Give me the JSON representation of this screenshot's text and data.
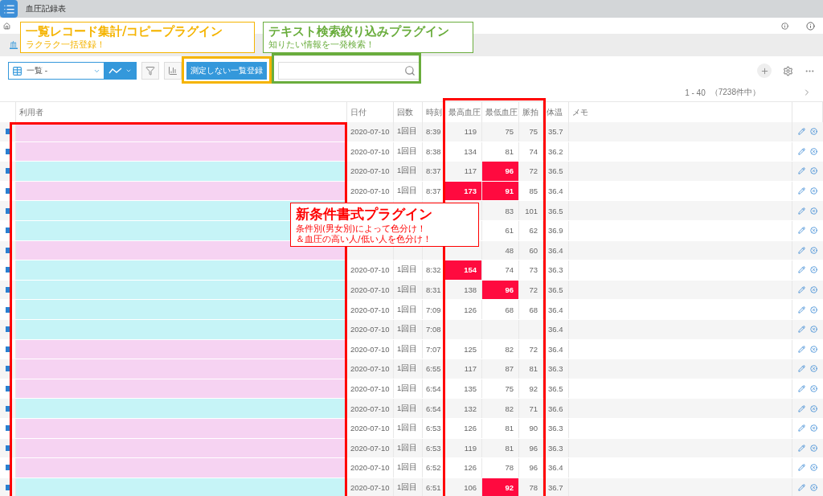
{
  "app": {
    "title": "血圧記録表"
  },
  "breadcrumb": "血",
  "toolbar": {
    "view_select": "一覧 -",
    "button": "測定しない一覧登録"
  },
  "pager": {
    "range": "1 - 40",
    "total": "（7238件中）"
  },
  "table": {
    "columns": [
      "利用者",
      "日付",
      "回数",
      "時刻",
      "最高血圧",
      "最低血圧",
      "脈拍",
      "体温",
      "メモ"
    ],
    "rows": [
      {
        "color": "#f6d3f2",
        "date": "2020-07-10",
        "count": "1回目",
        "time": "8:39",
        "high": "119",
        "high_alert": false,
        "low": "75",
        "low_alert": false,
        "pulse": "75",
        "temp": "35.7"
      },
      {
        "color": "#f6d3f2",
        "date": "2020-07-10",
        "count": "1回目",
        "time": "8:38",
        "high": "134",
        "high_alert": false,
        "low": "81",
        "low_alert": false,
        "pulse": "74",
        "temp": "36.2"
      },
      {
        "color": "#c6f4f7",
        "date": "2020-07-10",
        "count": "1回目",
        "time": "8:37",
        "high": "117",
        "high_alert": false,
        "low": "96",
        "low_alert": true,
        "pulse": "72",
        "temp": "36.5"
      },
      {
        "color": "#f6d3f2",
        "date": "2020-07-10",
        "count": "1回目",
        "time": "8:37",
        "high": "173",
        "high_alert": true,
        "low": "91",
        "low_alert": true,
        "pulse": "85",
        "temp": "36.4"
      },
      {
        "color": "#c6f4f7",
        "low": "83",
        "low_alert": false,
        "pulse": "101",
        "temp": "36.5"
      },
      {
        "color": "#c6f4f7",
        "low": "61",
        "low_alert": false,
        "pulse": "62",
        "temp": "36.9"
      },
      {
        "color": "#f6d3f2",
        "low": "48",
        "low_alert": false,
        "pulse": "60",
        "temp": "36.4"
      },
      {
        "color": "#c6f4f7",
        "date": "2020-07-10",
        "count": "1回目",
        "time": "8:32",
        "high": "154",
        "high_alert": true,
        "low": "74",
        "low_alert": false,
        "pulse": "73",
        "temp": "36.3"
      },
      {
        "color": "#c6f4f7",
        "date": "2020-07-10",
        "count": "1回目",
        "time": "8:31",
        "high": "138",
        "high_alert": false,
        "low": "96",
        "low_alert": true,
        "pulse": "72",
        "temp": "36.5"
      },
      {
        "color": "#c6f4f7",
        "date": "2020-07-10",
        "count": "1回目",
        "time": "7:09",
        "high": "126",
        "high_alert": false,
        "low": "68",
        "low_alert": false,
        "pulse": "68",
        "temp": "36.4"
      },
      {
        "color": "#c6f4f7",
        "date": "2020-07-10",
        "count": "1回目",
        "time": "7:08",
        "temp": "36.4"
      },
      {
        "color": "#f6d3f2",
        "date": "2020-07-10",
        "count": "1回目",
        "time": "7:07",
        "high": "125",
        "high_alert": false,
        "low": "82",
        "low_alert": false,
        "pulse": "72",
        "temp": "36.4"
      },
      {
        "color": "#f6d3f2",
        "date": "2020-07-10",
        "count": "1回目",
        "time": "6:55",
        "high": "117",
        "high_alert": false,
        "low": "87",
        "low_alert": false,
        "pulse": "81",
        "temp": "36.3"
      },
      {
        "color": "#f6d3f2",
        "date": "2020-07-10",
        "count": "1回目",
        "time": "6:54",
        "high": "135",
        "high_alert": false,
        "low": "75",
        "low_alert": false,
        "pulse": "92",
        "temp": "36.5"
      },
      {
        "color": "#c6f4f7",
        "date": "2020-07-10",
        "count": "1回目",
        "time": "6:54",
        "high": "132",
        "high_alert": false,
        "low": "82",
        "low_alert": false,
        "pulse": "71",
        "temp": "36.6"
      },
      {
        "color": "#f6d3f2",
        "date": "2020-07-10",
        "count": "1回目",
        "time": "6:53",
        "high": "126",
        "high_alert": false,
        "low": "81",
        "low_alert": false,
        "pulse": "90",
        "temp": "36.3"
      },
      {
        "color": "#f6d3f2",
        "date": "2020-07-10",
        "count": "1回目",
        "time": "6:53",
        "high": "119",
        "high_alert": false,
        "low": "81",
        "low_alert": false,
        "pulse": "96",
        "temp": "36.3"
      },
      {
        "color": "#f6d3f2",
        "date": "2020-07-10",
        "count": "1回目",
        "time": "6:52",
        "high": "126",
        "high_alert": false,
        "low": "78",
        "low_alert": false,
        "pulse": "96",
        "temp": "36.4"
      },
      {
        "color": "#c6f4f7",
        "date": "2020-07-10",
        "count": "1回目",
        "time": "6:51",
        "high": "106",
        "high_alert": false,
        "low": "92",
        "low_alert": true,
        "pulse": "78",
        "temp": "36.7"
      }
    ]
  },
  "annotations": [
    {
      "kind": "callout",
      "color": "#f5b400",
      "title": "一覧レコード集計/コピープラグイン",
      "lines": [
        "ラクラク一括登録！"
      ]
    },
    {
      "kind": "callout",
      "color": "#6aad3d",
      "title": "テキスト検索絞り込みプラグイン",
      "lines": [
        "知りたい情報を一発検索！"
      ]
    },
    {
      "kind": "callout",
      "color": "#ff0000",
      "title": "新条件書式プラグイン",
      "lines": [
        "条件別(男女別)によって色分け！",
        "＆血圧の高い人/低い人を色分け！"
      ]
    }
  ]
}
